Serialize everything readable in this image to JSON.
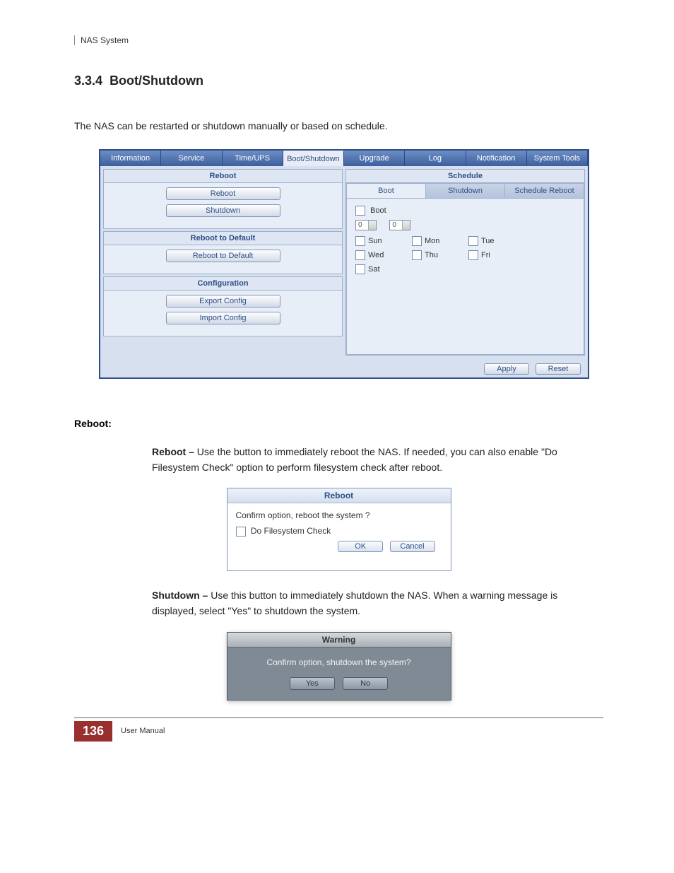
{
  "header": {
    "product": "NAS System"
  },
  "section": {
    "number": "3.3.4",
    "title": "Boot/Shutdown"
  },
  "intro": "The NAS can be restarted or shutdown manually or based on schedule.",
  "tabs": [
    "Information",
    "Service",
    "Time/UPS",
    "Boot/Shutdown",
    "Upgrade",
    "Log",
    "Notification",
    "System Tools"
  ],
  "left": {
    "reboot_title": "Reboot",
    "btn_reboot": "Reboot",
    "btn_shutdown": "Shutdown",
    "r2d_title": "Reboot to Default",
    "btn_r2d": "Reboot to Default",
    "cfg_title": "Configuration",
    "btn_export": "Export Config",
    "btn_import": "Import Config"
  },
  "right": {
    "schedule_title": "Schedule",
    "subtabs": [
      "Boot",
      "Shutdown",
      "Schedule Reboot"
    ],
    "boot_chk": "Boot",
    "hour": "0",
    "min": "0",
    "days": [
      "Sun",
      "Mon",
      "Tue",
      "Wed",
      "Thu",
      "Fri",
      "Sat"
    ],
    "apply": "Apply",
    "reset": "Reset"
  },
  "reboot_heading": "Reboot:",
  "reboot_desc_lead": "Reboot –",
  "reboot_desc": " Use the button to immediately reboot the NAS. If needed, you can also enable \"Do Filesystem Check\" option to perform filesystem check after reboot.",
  "dlg": {
    "title": "Reboot",
    "msg": "Confirm option, reboot the system ?",
    "chk": "Do Filesystem Check",
    "ok": "OK",
    "cancel": "Cancel"
  },
  "shutdown_desc_lead": "Shutdown –",
  "shutdown_desc": " Use this button to immediately shutdown the NAS. When a warning message is displayed, select \"Yes\" to shutdown the system.",
  "warn": {
    "title": "Warning",
    "msg": "Confirm option, shutdown the system?",
    "yes": "Yes",
    "no": "No"
  },
  "footer": {
    "page": "136",
    "label": "User Manual"
  }
}
